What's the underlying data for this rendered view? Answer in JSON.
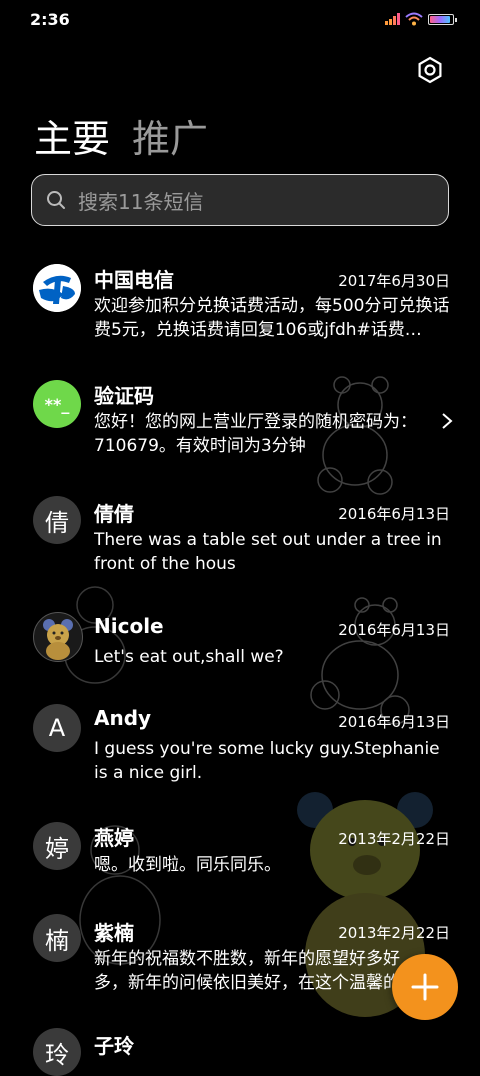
{
  "status_bar": {
    "time": "2:36",
    "icons": [
      "signal-icon",
      "wifi-icon",
      "battery-icon"
    ]
  },
  "header": {
    "settings_icon": "settings-icon"
  },
  "tabs": [
    {
      "label": "主要",
      "active": true
    },
    {
      "label": "推广",
      "active": false
    }
  ],
  "search": {
    "placeholder": "搜索11条短信"
  },
  "messages": [
    {
      "name": "中国电信",
      "date": "2017年6月30日",
      "preview": "欢迎参加积分兑换话费活动，每500分可兑换话费5元，兑换话费请回复106或jfdh#话费…",
      "avatar": "china-telecom-logo"
    },
    {
      "name": "验证码",
      "date": "",
      "preview": "您好！您的网上营业厅登录的随机密码为：710679。有效时间为3分钟",
      "avatar_text": "**_"
    },
    {
      "name": "倩倩",
      "date": "2016年6月13日",
      "preview": "There was a table set out under a tree in front of the hous",
      "avatar_text": "倩"
    },
    {
      "name": "Nicole",
      "date": "2016年6月13日",
      "preview": "Let's eat out,shall we?",
      "avatar": "bear-avatar"
    },
    {
      "name": "Andy",
      "date": "2016年6月13日",
      "preview": "I guess you're some lucky guy.Stephanie is a nice girl.",
      "avatar_text": "A"
    },
    {
      "name": "燕婷",
      "date": "2013年2月22日",
      "preview": "嗯。收到啦。同乐同乐。",
      "avatar_text": "婷"
    },
    {
      "name": "紫楠",
      "date": "2013年2月22日",
      "preview": "新年的祝福数不胜数，新年的愿望好多好多，新年的问候依旧美好，在这个温馨的时刻…",
      "avatar_text": "楠"
    },
    {
      "name": "子玲",
      "date": "",
      "preview": "",
      "avatar_text": "玲"
    }
  ],
  "fab": {
    "icon": "plus-icon"
  },
  "colors": {
    "accent": "#f3921d",
    "background": "#000000",
    "otp_avatar": "#6fd84a",
    "telecom_blue": "#0062c4"
  }
}
